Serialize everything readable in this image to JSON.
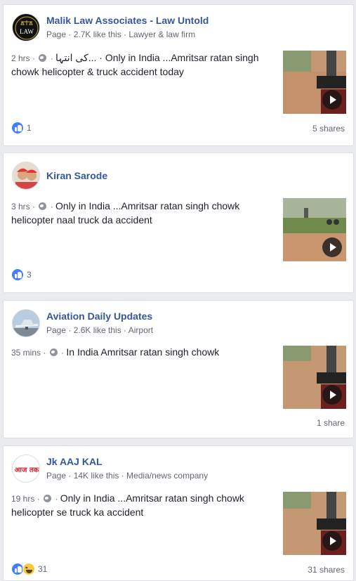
{
  "posts": [
    {
      "author": "Malik Law Associates - Law Untold",
      "meta": "Page · 2.7K like this · Lawyer & law firm",
      "time": "2 hrs",
      "text_line1": "کی انتہا... · Only in India ...Amritsar ratan singh",
      "text_line2": "chowk helicopter & truck accident today",
      "reaction_count": "1",
      "shares": "5 shares",
      "avatar_text": "LAW"
    },
    {
      "author": "Kiran Sarode",
      "meta": "",
      "time": "3 hrs",
      "text_line1": "Only in India ...Amritsar ratan singh chowk",
      "text_line2": "helicopter naal truck da accident",
      "reaction_count": "3",
      "shares": ""
    },
    {
      "author": "Aviation Daily Updates",
      "meta": "Page · 2.6K like this · Airport",
      "time": "35 mins",
      "text_line1": "In India Amritsar ratan singh chowk",
      "text_line2": "",
      "reaction_count": "",
      "shares": "1 share"
    },
    {
      "author": "Jk AAJ KAL",
      "meta": "Page · 14K like this · Media/news company",
      "time": "19 hrs",
      "text_line1": "Only in India ...Amritsar ratan singh chowk",
      "text_line2": "helicopter se truck ka accident",
      "reaction_count": "31",
      "shares": "31 shares",
      "avatar_text": "आज तक"
    }
  ],
  "icons": {
    "privacy": "globe-icon",
    "play": "play-icon",
    "like": "like-reaction-icon",
    "haha": "haha-reaction-icon"
  },
  "colors": {
    "link": "#365899",
    "like": "#4080ff",
    "background": "#e9ebee"
  }
}
